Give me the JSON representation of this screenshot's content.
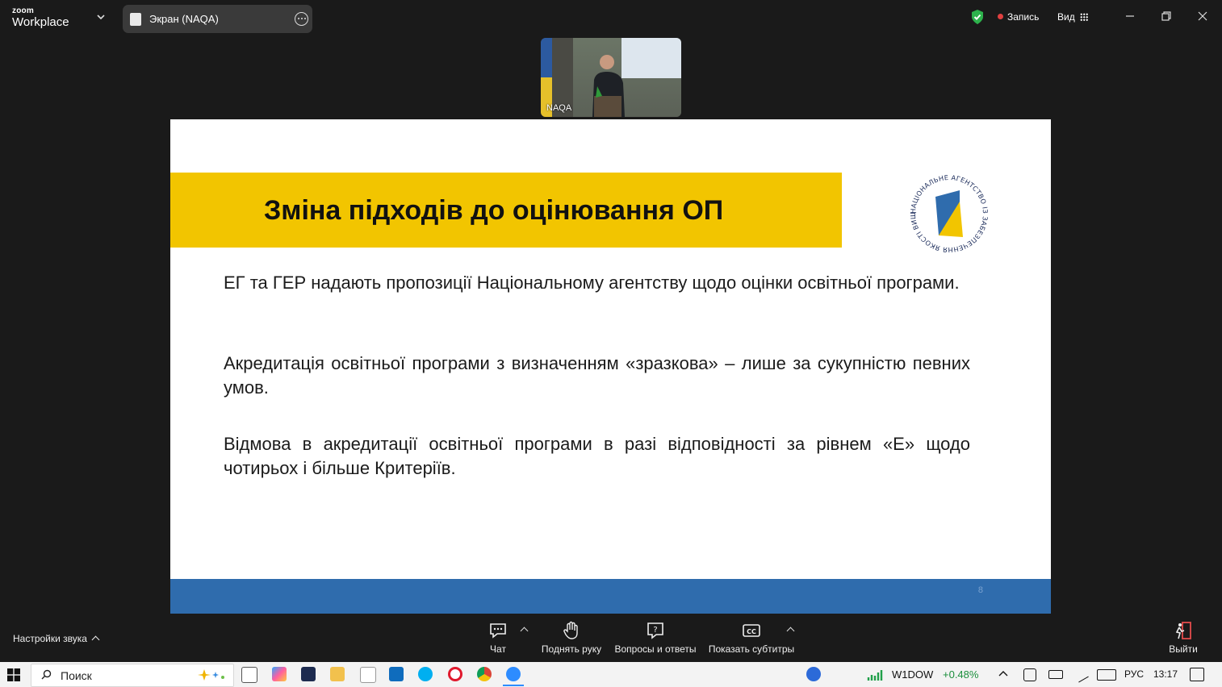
{
  "app": {
    "brand_line1": "zoom",
    "brand_line2": "Workplace"
  },
  "topbar": {
    "screen_tab_label": "Экран (NAQA)",
    "recording_label": "Запись",
    "view_label": "Вид"
  },
  "video": {
    "participant_name": "NAQA"
  },
  "slide": {
    "title": "Зміна підходів до оцінювання ОП",
    "paragraphs": [
      "ЕГ та ГЕР надають пропозиції Національному агентству щодо оцінки освітньої програми.",
      "Акредитація освітньої програми з визначенням «зразкова» – лише за сукупністю певних умов.",
      "Відмова в акредитації освітньої програми в разі відповідності за рівнем «Е» щодо чотирьох і більше Критеріїв."
    ],
    "page_number": "8",
    "logo_text": "НАЦІОНАЛЬНЕ АГЕНТСТВО ІЗ ЗАБЕЗПЕЧЕННЯ ЯКОСТІ ВИЩОЇ ОСВІТИ",
    "colors": {
      "band": "#f2c500",
      "footer": "#2f6cad"
    }
  },
  "toolbar": {
    "audio_settings_label": "Настройки звука",
    "chat_label": "Чат",
    "raise_hand_label": "Поднять руку",
    "qa_label": "Вопросы и ответы",
    "captions_label": "Показать субтитры",
    "leave_label": "Выйти"
  },
  "taskbar": {
    "search_placeholder": "Поиск",
    "stock_label": "W1DOW",
    "stock_change": "+0.48%",
    "language": "РУС",
    "time": "13:17"
  }
}
